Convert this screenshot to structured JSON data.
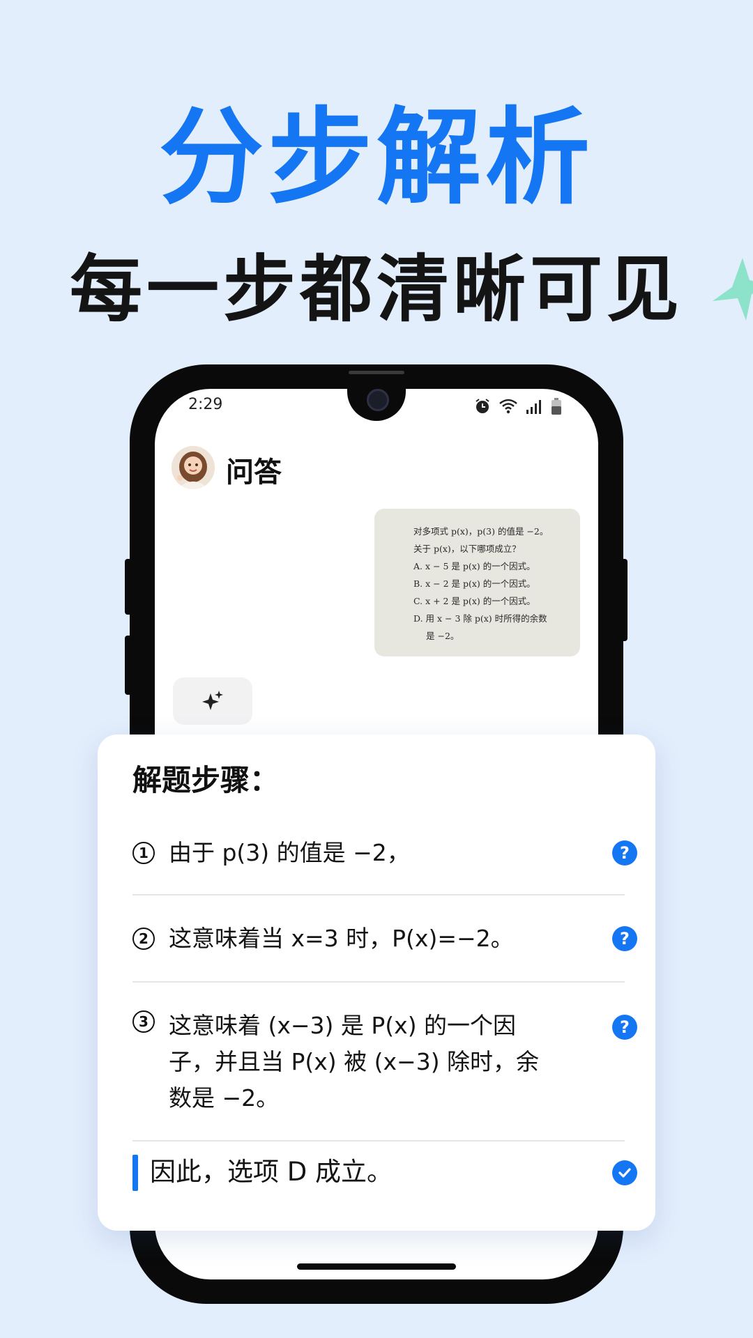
{
  "headline": {
    "title": "分步解析",
    "subtitle": "每一步都清晰可见"
  },
  "phone": {
    "status": {
      "time": "2:29"
    },
    "chat_title": "问答",
    "question": {
      "lines": [
        "对多项式 p(x)，p(3) 的值是 −2。",
        "关于 p(x)，以下哪项成立？",
        "A.  x − 5 是 p(x) 的一个因式。",
        "B.  x − 2 是 p(x) 的一个因式。",
        "C.  x + 2 是 p(x) 的一个因式。",
        "D.  用 x − 3 除 p(x) 时所得的余数",
        "是 −2。"
      ]
    }
  },
  "steps": {
    "title": "解题步骤：",
    "items": [
      {
        "num": "1",
        "text": "由于 p(3) 的值是 −2，"
      },
      {
        "num": "2",
        "text": "这意味着当 x=3 时，P(x)=−2。"
      },
      {
        "num": "3",
        "text": "这意味着 (x−3) 是 P(x) 的一个因子，并且当 P(x) 被 (x−3) 除时，余数是 −2。"
      }
    ],
    "help_icon": "?",
    "conclusion": "因此，选项 D 成立。"
  },
  "colors": {
    "accent": "#1476F2",
    "background": "#E3EEFC",
    "headline_dark": "#141414"
  },
  "icons": {
    "ai": "sparkle-icon",
    "help": "question-circle-icon",
    "done": "check-circle-icon",
    "alarm": "alarm-icon",
    "wifi": "wifi-icon",
    "signal": "signal-icon",
    "battery": "battery-icon"
  }
}
